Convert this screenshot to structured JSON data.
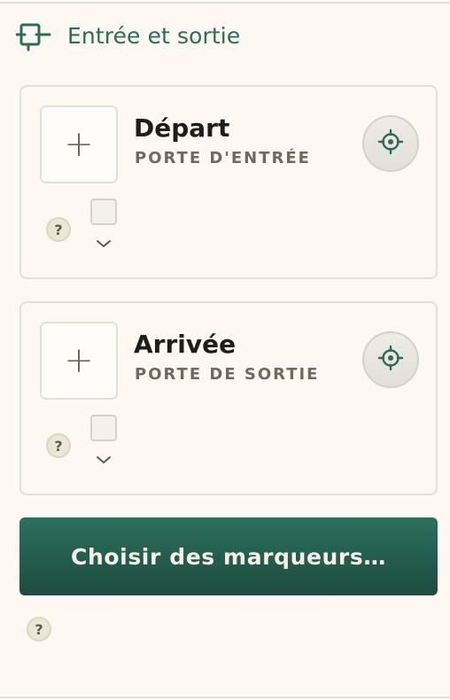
{
  "header": {
    "title": "Entrée et sortie",
    "icon": "door-bracket-icon"
  },
  "cards": [
    {
      "title": "Départ",
      "subtitle": "PORTE D'ENTRÉE",
      "add_symbol": "+",
      "help_symbol": "?"
    },
    {
      "title": "Arrivée",
      "subtitle": "PORTE DE SORTIE",
      "add_symbol": "+",
      "help_symbol": "?"
    }
  ],
  "primary_button": {
    "label": "Choisir des marqueurs…"
  },
  "footer": {
    "help_symbol": "?"
  },
  "colors": {
    "accent": "#2e6b5a",
    "button_top": "#2c6f5c",
    "button_bottom": "#1e4c3f",
    "background": "#fdf9f2"
  }
}
